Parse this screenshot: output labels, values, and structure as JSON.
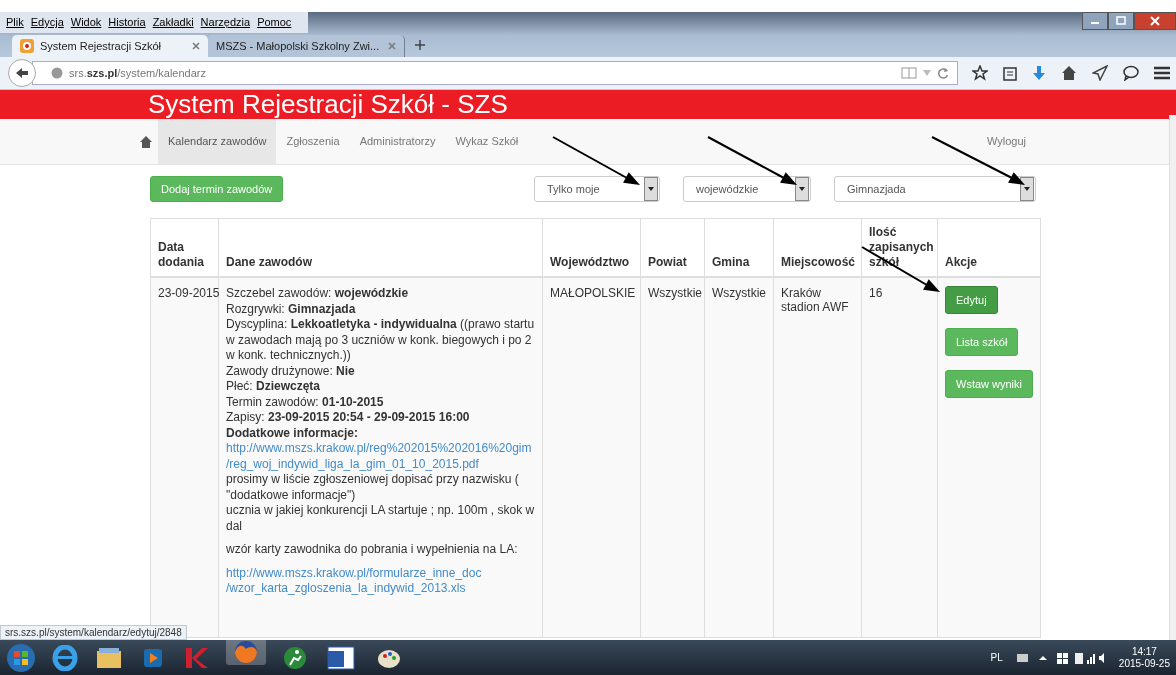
{
  "menu_bar": [
    "Plik",
    "Edycja",
    "Widok",
    "Historia",
    "Zakładki",
    "Narzędzia",
    "Pomoc"
  ],
  "tabs": [
    {
      "label": "System Rejestracji Szkół",
      "selected": true
    },
    {
      "label": "MSZS - Małopolski Szkolny Zwi...",
      "selected": false
    }
  ],
  "address_bar": {
    "prefix": "srs.",
    "domain": "szs.pl",
    "path": "/system/kalendarz"
  },
  "site_title": "System Rejestracji Szkół - SZS",
  "nav": [
    {
      "label": "Kalendarz zawodów",
      "selected": true
    },
    {
      "label": "Zgłoszenia",
      "selected": false
    },
    {
      "label": "Administratorzy",
      "selected": false
    },
    {
      "label": "Wykaz Szkół",
      "selected": false
    }
  ],
  "logout": "Wyloguj",
  "add_button": "Dodaj termin zawodów",
  "filters": [
    "Tylko moje",
    "wojewódzkie",
    "Gimnazjada"
  ],
  "table": {
    "columns": [
      "Data dodania",
      "Dane zawodów",
      "Województwo",
      "Powiat",
      "Gmina",
      "Miejscowość",
      "Ilość zapisanych szkół",
      "Akcje"
    ],
    "rows": [
      {
        "date": "23-09-2015",
        "details": [
          {
            "kind": "text",
            "text": "Szczebel zawodów: **wojewódzkie**"
          },
          {
            "kind": "text",
            "text": "Rozgrywki: **Gimnazjada**"
          },
          {
            "kind": "text",
            "text": "Dyscyplina: **Lekkoatletyka - indywidualna** ((prawo startu w zawodach mają po 3 uczniów w konk. biegowych i po 2 w konk. technicznych.))"
          },
          {
            "kind": "text",
            "text": "Zawody drużynowe: **Nie**"
          },
          {
            "kind": "text",
            "text": "Płeć: **Dziewczęta**"
          },
          {
            "kind": "text",
            "text": "Termin zawodów: **01-10-2015**"
          },
          {
            "kind": "text",
            "text": "Zapisy: **23-09-2015 20:54 - 29-09-2015 16:00**"
          },
          {
            "kind": "heading",
            "text": "Dodatkowe informacje:"
          },
          {
            "kind": "link",
            "text": "http://www.mszs.krakow.pl/reg%202015%202016%20gim /reg_woj_indywid_liga_la_gim_01_10_2015.pdf"
          },
          {
            "kind": "text",
            "text": "prosimy w liście zgłoszeniowej dopisać przy nazwisku ( \"dodatkowe informacje\")"
          },
          {
            "kind": "text",
            "text": "ucznia w jakiej konkurencji LA startuje ; np. 100m , skok w dal"
          },
          {
            "kind": "paragraph",
            "text": "wzór karty zawodnika do pobrania i wypełnienia na LA:"
          },
          {
            "kind": "paragraph-link",
            "text": "http://www.mszs.krakow.pl/formularze_inne_doc /wzor_karta_zgloszenia_la_indywid_2013.xls"
          }
        ],
        "voivodeship": "MAŁOPOLSKIE",
        "district": "Wszystkie",
        "commune": "Wszystkie",
        "place": "Kraków stadion AWF",
        "schools": "16",
        "actions": [
          {
            "label": "Edytuj",
            "hover": true
          },
          {
            "label": "Lista szkół",
            "hover": false
          },
          {
            "label": "Wstaw wyniki",
            "hover": false
          }
        ]
      }
    ]
  },
  "status_url": "srs.szs.pl/system/kalendarz/edytuj/2848",
  "tray": {
    "language": "PL",
    "time": "14:17",
    "date": "2015-09-25"
  }
}
